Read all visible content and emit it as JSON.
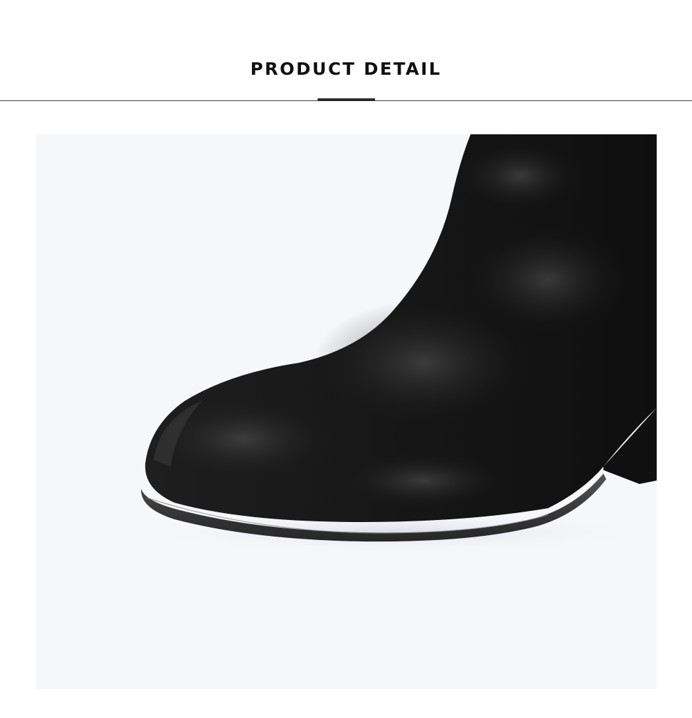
{
  "header": {
    "title": "PRODUCT DETAIL"
  },
  "photo": {
    "subject": "black-suede-ankle-boot-toe-closeup",
    "background_color": "#f6f7f9",
    "boot_color": "#1a1a1a",
    "sole_color": "#3b3b3b"
  }
}
